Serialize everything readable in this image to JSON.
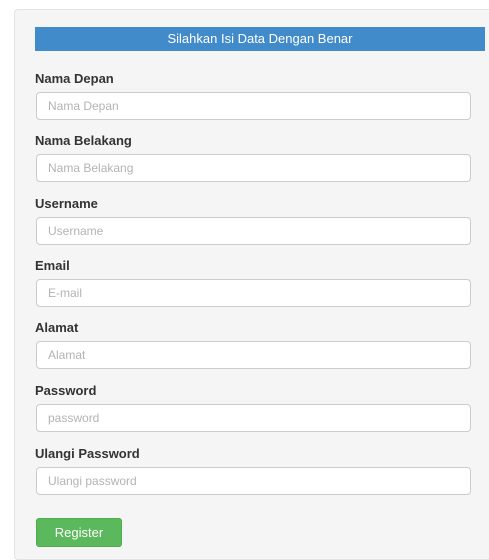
{
  "form": {
    "header": "Silahkan Isi Data Dengan Benar",
    "fields": [
      {
        "label": "Nama Depan",
        "placeholder": "Nama Depan",
        "value": ""
      },
      {
        "label": "Nama Belakang",
        "placeholder": "Nama Belakang",
        "value": ""
      },
      {
        "label": "Username",
        "placeholder": "Username",
        "value": ""
      },
      {
        "label": "Email",
        "placeholder": "E-mail",
        "value": ""
      },
      {
        "label": "Alamat",
        "placeholder": "Alamat",
        "value": ""
      },
      {
        "label": "Password",
        "placeholder": "password",
        "value": ""
      },
      {
        "label": "Ulangi Password",
        "placeholder": "Ulangi password",
        "value": ""
      }
    ],
    "submit_label": "Register"
  },
  "colors": {
    "header_bg": "#428bca",
    "panel_bg": "#f5f5f5",
    "button_bg": "#5cb85c"
  }
}
